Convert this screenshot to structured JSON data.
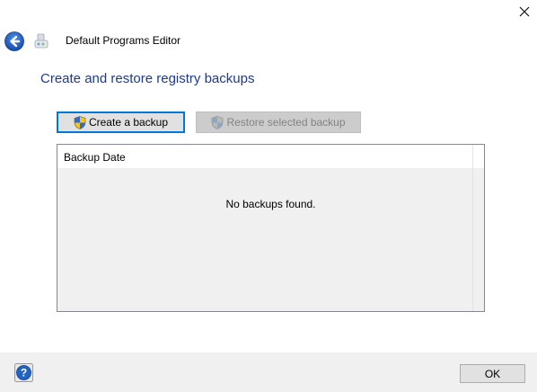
{
  "window": {
    "close_icon": "close-icon"
  },
  "header": {
    "back_icon": "back-arrow-icon",
    "app_icon": "default-programs-icon",
    "app_title": "Default Programs Editor"
  },
  "main": {
    "heading": "Create and restore registry backups",
    "create_button": {
      "label": "Create a backup",
      "icon": "uac-shield-icon"
    },
    "restore_button": {
      "label": "Restore selected backup",
      "icon": "uac-shield-icon",
      "enabled": false
    },
    "backup_list": {
      "columns": [
        "Backup Date"
      ],
      "rows": [],
      "empty_message": "No backups found."
    }
  },
  "footer": {
    "help_icon": "help-icon",
    "ok_label": "OK"
  },
  "colors": {
    "heading": "#1e3a8c",
    "focus_border": "#0078d7",
    "footer_bg": "#f0f0f0",
    "back_button": "#1a64c8"
  }
}
